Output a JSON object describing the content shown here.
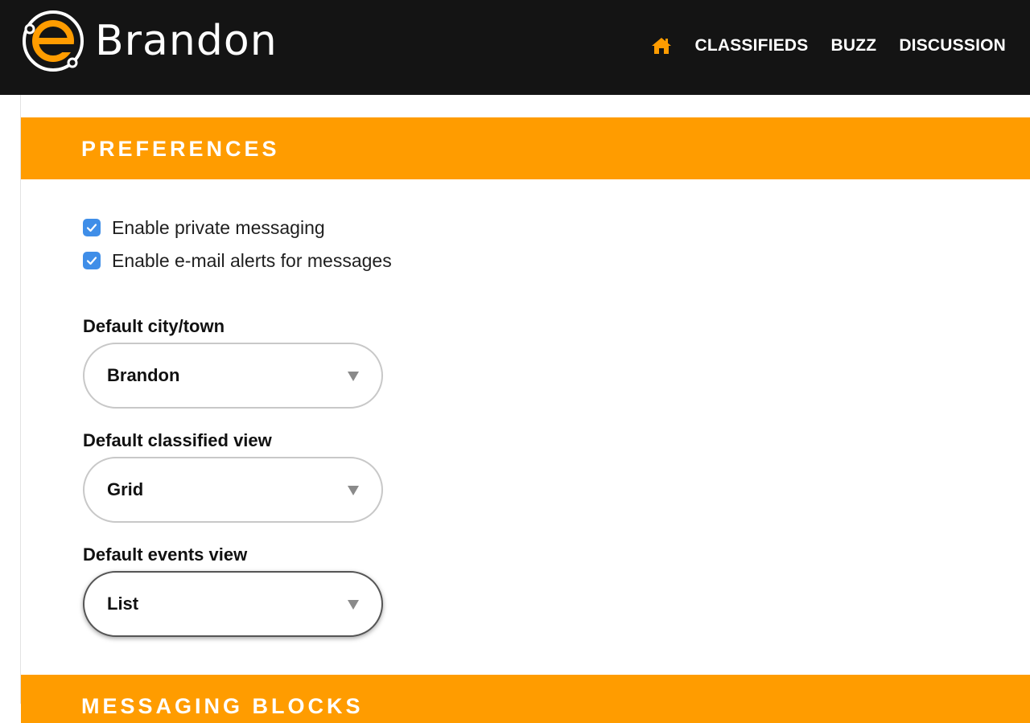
{
  "header": {
    "logo_text": "Brandon",
    "nav": {
      "classifieds": "CLASSIFIEDS",
      "buzz": "BUZZ",
      "discussion": "DISCUSSION"
    }
  },
  "preferences": {
    "title": "PREFERENCES",
    "checkboxes": [
      {
        "label": "Enable private messaging",
        "checked": true
      },
      {
        "label": "Enable e-mail alerts for messages",
        "checked": true
      }
    ],
    "fields": {
      "city": {
        "label": "Default city/town",
        "value": "Brandon"
      },
      "classified": {
        "label": "Default classified view",
        "value": "Grid"
      },
      "events": {
        "label": "Default events view",
        "value": "List"
      }
    }
  },
  "messaging_blocks": {
    "title": "MESSAGING BLOCKS"
  },
  "colors": {
    "accent": "#ff9c00",
    "header_bg": "#141414",
    "checkbox": "#3f8ee8"
  },
  "icons": {
    "logo": "e-logo-icon",
    "home": "home-icon",
    "check": "checkmark-icon",
    "caret": "caret-down-icon"
  }
}
